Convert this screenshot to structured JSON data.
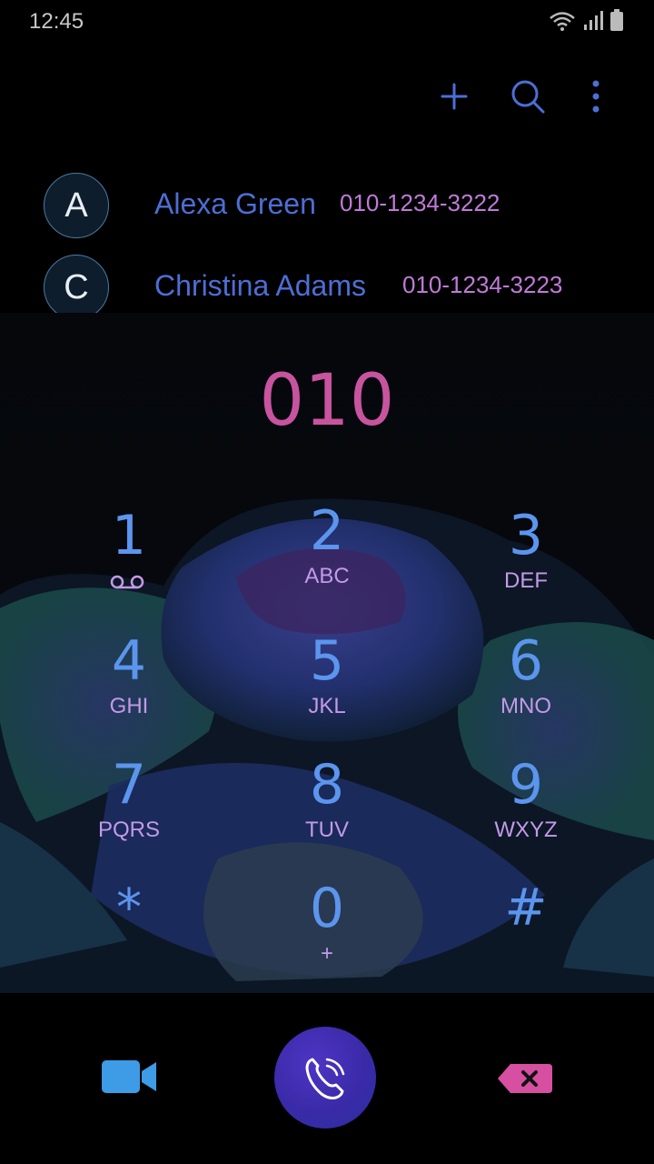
{
  "status_bar": {
    "time": "12:45"
  },
  "action_bar": {
    "icons": {
      "add": "plus-icon",
      "search": "search-icon",
      "more": "more-vertical-icon"
    }
  },
  "contacts": [
    {
      "initial": "A",
      "name": "Alexa Green",
      "number": "010-1234-3222"
    },
    {
      "initial": "C",
      "name": "Christina Adams",
      "number": "010-1234-3223"
    }
  ],
  "dialer": {
    "entered_number": "010",
    "keys": [
      {
        "digit": "1",
        "letters": ""
      },
      {
        "digit": "2",
        "letters": "ABC"
      },
      {
        "digit": "3",
        "letters": "DEF"
      },
      {
        "digit": "4",
        "letters": "GHI"
      },
      {
        "digit": "5",
        "letters": "JKL"
      },
      {
        "digit": "6",
        "letters": "MNO"
      },
      {
        "digit": "7",
        "letters": "PQRS"
      },
      {
        "digit": "8",
        "letters": "TUV"
      },
      {
        "digit": "9",
        "letters": "WXYZ"
      },
      {
        "digit": "*",
        "letters": ""
      },
      {
        "digit": "0",
        "letters": "+"
      },
      {
        "digit": "#",
        "letters": ""
      }
    ]
  },
  "bottom_bar": {
    "icons": {
      "video": "video-call-icon",
      "call": "phone-call-icon",
      "delete": "backspace-icon"
    }
  },
  "colors": {
    "accent_blue": "#5b95ee",
    "letters_purple": "#c39ae8",
    "number_pink": "#c8549f",
    "name_blue": "#4d6ed4",
    "contact_number": "#c07ad8"
  }
}
